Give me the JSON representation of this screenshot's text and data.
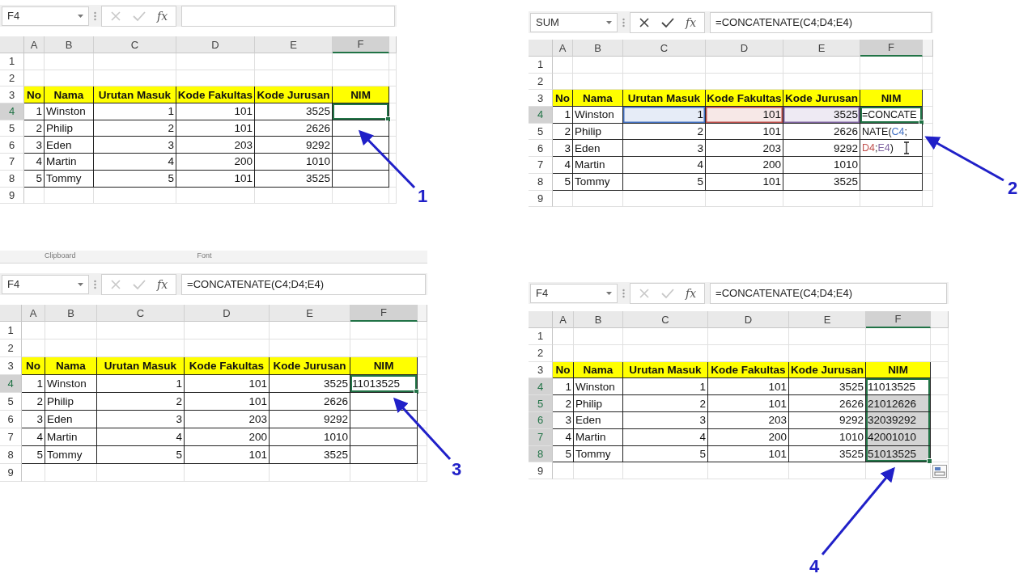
{
  "panels": [
    {
      "name_box": "F4",
      "editing": false,
      "fx_label": "fx",
      "columns": [
        {
          "label": "A",
          "selected": false
        },
        {
          "label": "B",
          "selected": false
        },
        {
          "label": "C",
          "selected": false
        },
        {
          "label": "D",
          "selected": false
        },
        {
          "label": "E",
          "selected": false
        },
        {
          "label": "F",
          "selected": true
        }
      ],
      "row_headers": [
        {
          "label": "1",
          "selected": false
        },
        {
          "label": "2",
          "selected": false
        },
        {
          "label": "3",
          "selected": false
        },
        {
          "label": "4",
          "selected": true
        },
        {
          "label": "5",
          "selected": false
        },
        {
          "label": "6",
          "selected": false
        },
        {
          "label": "7",
          "selected": false
        },
        {
          "label": "8",
          "selected": false
        },
        {
          "label": "9",
          "selected": false
        }
      ],
      "table_header": [
        "No",
        "Nama",
        "Urutan Masuk",
        "Kode Fakultas",
        "Kode Jurusan",
        "NIM"
      ],
      "rows": [
        {
          "cells": [
            "1",
            "Winston",
            "1",
            "101",
            "3525"
          ],
          "selected": true,
          "shaded": false
        },
        {
          "cells": [
            "2",
            "Philip",
            "2",
            "101",
            "2626"
          ],
          "selected": false,
          "shaded": false
        },
        {
          "cells": [
            "3",
            "Eden",
            "3",
            "203",
            "9292"
          ],
          "selected": false,
          "shaded": false
        },
        {
          "cells": [
            "4",
            "Martin",
            "4",
            "200",
            "1010"
          ],
          "selected": false,
          "shaded": false
        },
        {
          "cells": [
            "5",
            "Tommy",
            "5",
            "101",
            "3525"
          ],
          "selected": false,
          "shaded": false
        }
      ],
      "callout": "1"
    },
    {
      "name_box": "SUM",
      "editing": true,
      "fx_label": "fx",
      "formula": "=CONCATENATE(C4;D4;E4)",
      "columns": [
        {
          "label": "A",
          "selected": false
        },
        {
          "label": "B",
          "selected": false
        },
        {
          "label": "C",
          "selected": false
        },
        {
          "label": "D",
          "selected": false
        },
        {
          "label": "E",
          "selected": false
        },
        {
          "label": "F",
          "selected": true
        }
      ],
      "row_headers": [
        {
          "label": "1",
          "selected": false
        },
        {
          "label": "2",
          "selected": false
        },
        {
          "label": "3",
          "selected": false
        },
        {
          "label": "4",
          "selected": true
        },
        {
          "label": "5",
          "selected": false
        },
        {
          "label": "6",
          "selected": false
        },
        {
          "label": "7",
          "selected": false
        },
        {
          "label": "8",
          "selected": false
        },
        {
          "label": "9",
          "selected": false
        }
      ],
      "table_header": [
        "No",
        "Nama",
        "Urutan Masuk",
        "Kode Fakultas",
        "Kode Jurusan",
        "NIM"
      ],
      "rows": [
        {
          "cells": [
            "1",
            "Winston",
            {
              "text": "1",
              "color": "#4472c4"
            },
            {
              "text": "101",
              "color": "#c0504d"
            },
            {
              "text": "3525",
              "color": "#8064a2"
            }
          ],
          "selected": true,
          "shaded": false
        },
        {
          "cells": [
            "2",
            "Philip",
            "2",
            "101",
            "2626"
          ],
          "selected": false,
          "shaded": false
        },
        {
          "cells": [
            "3",
            "Eden",
            "3",
            "203",
            "9292"
          ],
          "selected": false,
          "shaded": false
        },
        {
          "cells": [
            "4",
            "Martin",
            "4",
            "200",
            "1010"
          ],
          "selected": false,
          "shaded": false
        },
        {
          "cells": [
            "5",
            "Tommy",
            "5",
            "101",
            "3525"
          ],
          "selected": false,
          "shaded": false
        }
      ],
      "cell_edit": [
        [
          {
            "text": "=CONCATE"
          }
        ],
        [
          {
            "text": "NATE("
          },
          {
            "text": "C4",
            "color": "#4472c4"
          },
          {
            "text": ";"
          }
        ],
        [
          {
            "text": "D4",
            "color": "#c0504d"
          },
          {
            "text": ";"
          },
          {
            "text": "E4",
            "color": "#8064a2"
          },
          {
            "text": ")"
          }
        ]
      ],
      "callout": "2"
    },
    {
      "ribbon_groups": [
        "Clipboard",
        "Font"
      ],
      "name_box": "F4",
      "editing": false,
      "fx_label": "fx",
      "formula": "=CONCATENATE(C4;D4;E4)",
      "columns": [
        {
          "label": "A",
          "selected": false
        },
        {
          "label": "B",
          "selected": false
        },
        {
          "label": "C",
          "selected": false
        },
        {
          "label": "D",
          "selected": false
        },
        {
          "label": "E",
          "selected": false
        },
        {
          "label": "F",
          "selected": true
        }
      ],
      "row_headers": [
        {
          "label": "1",
          "selected": false
        },
        {
          "label": "2",
          "selected": false
        },
        {
          "label": "3",
          "selected": false
        },
        {
          "label": "4",
          "selected": true
        },
        {
          "label": "5",
          "selected": false
        },
        {
          "label": "6",
          "selected": false
        },
        {
          "label": "7",
          "selected": false
        },
        {
          "label": "8",
          "selected": false
        },
        {
          "label": "9",
          "selected": false
        }
      ],
      "table_header": [
        "No",
        "Nama",
        "Urutan Masuk",
        "Kode Fakultas",
        "Kode Jurusan",
        "NIM"
      ],
      "rows": [
        {
          "cells": [
            "1",
            "Winston",
            "1",
            "101",
            "3525"
          ],
          "nim": "11013525",
          "selected": true,
          "shaded": false
        },
        {
          "cells": [
            "2",
            "Philip",
            "2",
            "101",
            "2626"
          ],
          "selected": false,
          "shaded": false
        },
        {
          "cells": [
            "3",
            "Eden",
            "3",
            "203",
            "9292"
          ],
          "selected": false,
          "shaded": false
        },
        {
          "cells": [
            "4",
            "Martin",
            "4",
            "200",
            "1010"
          ],
          "selected": false,
          "shaded": false
        },
        {
          "cells": [
            "5",
            "Tommy",
            "5",
            "101",
            "3525"
          ],
          "selected": false,
          "shaded": false
        }
      ],
      "callout": "3"
    },
    {
      "name_box": "F4",
      "editing": false,
      "fx_label": "fx",
      "formula": "=CONCATENATE(C4;D4;E4)",
      "columns": [
        {
          "label": "A",
          "selected": false
        },
        {
          "label": "B",
          "selected": false
        },
        {
          "label": "C",
          "selected": false
        },
        {
          "label": "D",
          "selected": false
        },
        {
          "label": "E",
          "selected": false
        },
        {
          "label": "F",
          "selected": true
        }
      ],
      "row_headers": [
        {
          "label": "1",
          "selected": false
        },
        {
          "label": "2",
          "selected": false
        },
        {
          "label": "3",
          "selected": false
        },
        {
          "label": "4",
          "selected": true
        },
        {
          "label": "5",
          "selected": true
        },
        {
          "label": "6",
          "selected": true
        },
        {
          "label": "7",
          "selected": true
        },
        {
          "label": "8",
          "selected": true
        },
        {
          "label": "9",
          "selected": false
        }
      ],
      "table_header": [
        "No",
        "Nama",
        "Urutan Masuk",
        "Kode Fakultas",
        "Kode Jurusan",
        "NIM"
      ],
      "rows": [
        {
          "cells": [
            "1",
            "Winston",
            "1",
            "101",
            "3525"
          ],
          "nim": "11013525",
          "selected": true,
          "shaded": false
        },
        {
          "cells": [
            "2",
            "Philip",
            "2",
            "101",
            "2626"
          ],
          "nim": "21012626",
          "selected": true,
          "shaded": true
        },
        {
          "cells": [
            "3",
            "Eden",
            "3",
            "203",
            "9292"
          ],
          "nim": "32039292",
          "selected": true,
          "shaded": true
        },
        {
          "cells": [
            "4",
            "Martin",
            "4",
            "200",
            "1010"
          ],
          "nim": "42001010",
          "selected": true,
          "shaded": true
        },
        {
          "cells": [
            "5",
            "Tommy",
            "5",
            "101",
            "3525"
          ],
          "nim": "51013525",
          "selected": true,
          "shaded": true
        }
      ],
      "quick_analysis": true,
      "callout": "4"
    }
  ]
}
